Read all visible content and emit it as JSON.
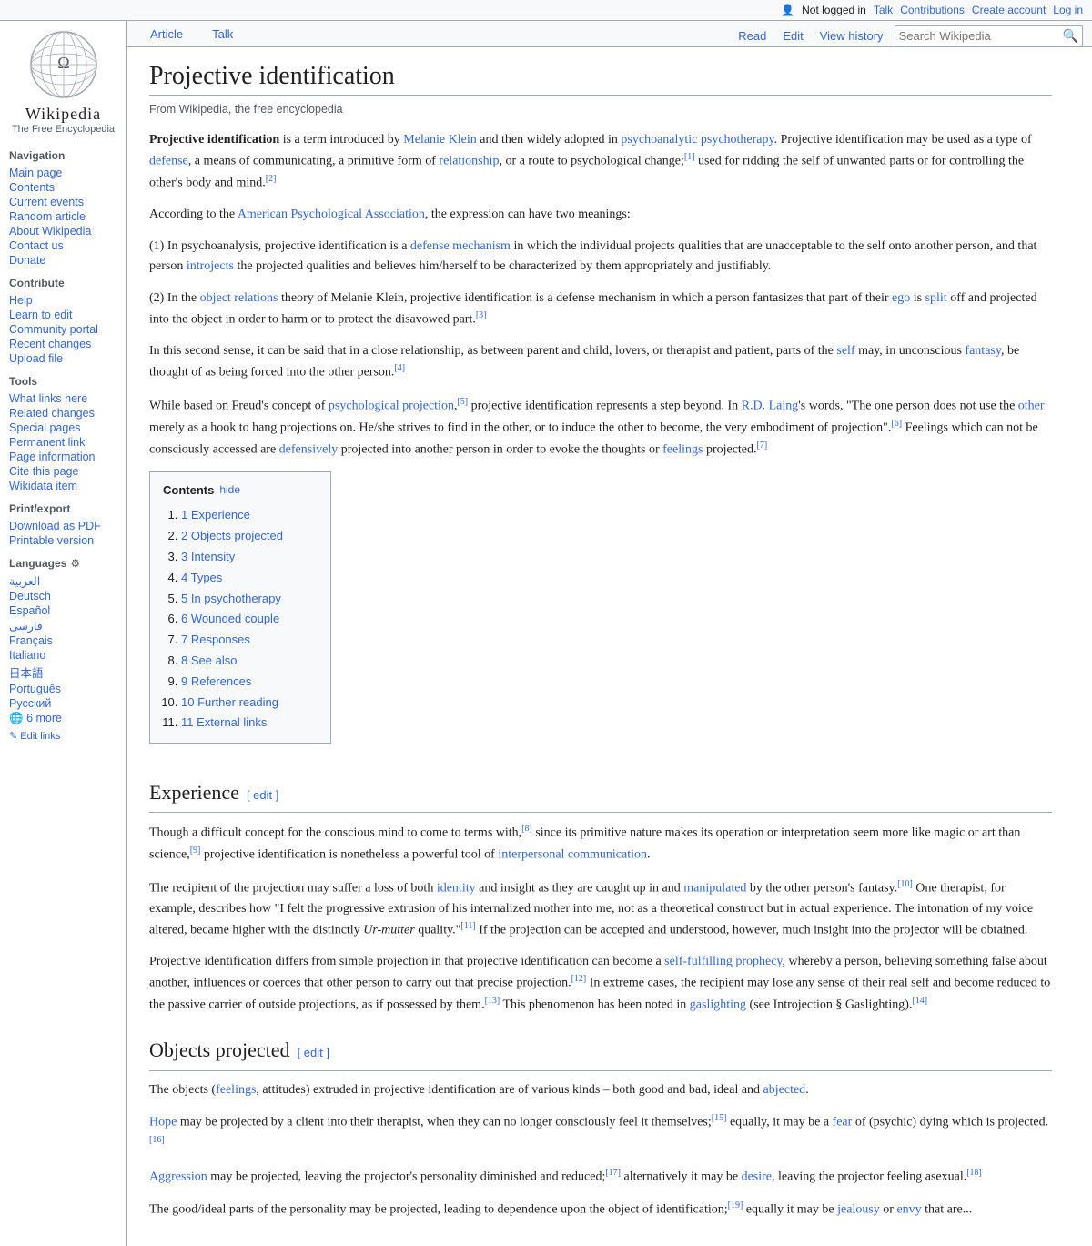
{
  "topbar": {
    "not_logged_in": "Not logged in",
    "talk": "Talk",
    "contributions": "Contributions",
    "create_account": "Create account",
    "log_in": "Log in"
  },
  "logo": {
    "title": "Wikipedia",
    "subtitle": "The Free Encyclopedia"
  },
  "sidebar": {
    "navigation_title": "Navigation",
    "items_nav": [
      {
        "label": "Main page",
        "id": "main-page"
      },
      {
        "label": "Contents",
        "id": "contents"
      },
      {
        "label": "Current events",
        "id": "current-events"
      },
      {
        "label": "Random article",
        "id": "random-article"
      },
      {
        "label": "About Wikipedia",
        "id": "about-wikipedia"
      },
      {
        "label": "Contact us",
        "id": "contact-us"
      },
      {
        "label": "Donate",
        "id": "donate"
      }
    ],
    "contribute_title": "Contribute",
    "items_contribute": [
      {
        "label": "Help",
        "id": "help"
      },
      {
        "label": "Learn to edit",
        "id": "learn-to-edit"
      },
      {
        "label": "Community portal",
        "id": "community-portal"
      },
      {
        "label": "Recent changes",
        "id": "recent-changes"
      },
      {
        "label": "Upload file",
        "id": "upload-file"
      }
    ],
    "tools_title": "Tools",
    "items_tools": [
      {
        "label": "What links here",
        "id": "what-links-here"
      },
      {
        "label": "Related changes",
        "id": "related-changes"
      },
      {
        "label": "Special pages",
        "id": "special-pages"
      },
      {
        "label": "Permanent link",
        "id": "permanent-link"
      },
      {
        "label": "Page information",
        "id": "page-information"
      },
      {
        "label": "Cite this page",
        "id": "cite-this-page"
      },
      {
        "label": "Wikidata item",
        "id": "wikidata-item"
      }
    ],
    "print_title": "Print/export",
    "items_print": [
      {
        "label": "Download as PDF",
        "id": "download-pdf"
      },
      {
        "label": "Printable version",
        "id": "printable-version"
      }
    ],
    "languages_title": "Languages",
    "languages": [
      {
        "label": "العربية",
        "id": "lang-ar"
      },
      {
        "label": "Deutsch",
        "id": "lang-de"
      },
      {
        "label": "Español",
        "id": "lang-es"
      },
      {
        "label": "فارسی",
        "id": "lang-fa"
      },
      {
        "label": "Français",
        "id": "lang-fr"
      },
      {
        "label": "Italiano",
        "id": "lang-it"
      },
      {
        "label": "日本語",
        "id": "lang-ja"
      },
      {
        "label": "Português",
        "id": "lang-pt"
      },
      {
        "label": "Русский",
        "id": "lang-ru"
      }
    ],
    "more_languages": "6 more",
    "edit_links": "✎ Edit links"
  },
  "tabs": {
    "article": "Article",
    "talk": "Talk",
    "read": "Read",
    "edit": "Edit",
    "view_history": "View history",
    "search_placeholder": "Search Wikipedia"
  },
  "page": {
    "title": "Projective identification",
    "from_wiki": "From Wikipedia, the free encyclopedia",
    "intro": [
      {
        "text": "Projective identification",
        "bold": true
      }
    ],
    "intro_rest": " is a term introduced by Melanie Klein and then widely adopted in psychoanalytic psychotherapy. Projective identification may be used as a type of defense, a means of communicating, a primitive form of relationship, or a route to psychological change;[1] used for ridding the self of unwanted parts or for controlling the other's body and mind.[2]",
    "para2": "According to the American Psychological Association, the expression can have two meanings:",
    "para3": "(1) In psychoanalysis, projective identification is a defense mechanism in which the individual projects qualities that are unacceptable to the self onto another person, and that person introjects the projected qualities and believes him/herself to be characterized by them appropriately and justifiably.",
    "para4": "(2) In the object relations theory of Melanie Klein, projective identification is a defense mechanism in which a person fantasizes that part of their ego is split off and projected into the object in order to harm or to protect the disavowed part.[3]",
    "para5": "In this second sense, it can be said that in a close relationship, as between parent and child, lovers, or therapist and patient, parts of the self may, in unconscious fantasy, be thought of as being forced into the other person.[4]",
    "para6": "While based on Freud's concept of psychological projection,[5] projective identification represents a step beyond. In R.D. Laing's words, \"The one person does not use the other merely as a hook to hang projections on. He/she strives to find in the other, or to induce the other to become, the very embodiment of projection\".[6] Feelings which can not be consciously accessed are defensively projected into another person in order to evoke the thoughts or feelings projected.[7]",
    "toc": {
      "title": "Contents",
      "hide": "hide",
      "items": [
        {
          "num": "1",
          "label": "Experience"
        },
        {
          "num": "2",
          "label": "Objects projected"
        },
        {
          "num": "3",
          "label": "Intensity"
        },
        {
          "num": "4",
          "label": "Types"
        },
        {
          "num": "5",
          "label": "In psychotherapy"
        },
        {
          "num": "6",
          "label": "Wounded couple"
        },
        {
          "num": "7",
          "label": "Responses"
        },
        {
          "num": "8",
          "label": "See also"
        },
        {
          "num": "9",
          "label": "References"
        },
        {
          "num": "10",
          "label": "Further reading"
        },
        {
          "num": "11",
          "label": "External links"
        }
      ]
    },
    "sections": [
      {
        "id": "experience",
        "title": "Experience",
        "edit_label": "edit",
        "paragraphs": [
          "Though a difficult concept for the conscious mind to come to terms with,[8] since its primitive nature makes its operation or interpretation seem more like magic or art than science,[9] projective identification is nonetheless a powerful tool of interpersonal communication.",
          "The recipient of the projection may suffer a loss of both identity and insight as they are caught up in and manipulated by the other person's fantasy.[10] One therapist, for example, describes how \"I felt the progressive extrusion of his internalized mother into me, not as a theoretical construct but in actual experience. The intonation of my voice altered, became higher with the distinctly Ur-mutter quality.\"[11] If the projection can be accepted and understood, however, much insight into the projector will be obtained.",
          "Projective identification differs from simple projection in that projective identification can become a self-fulfilling prophecy, whereby a person, believing something false about another, influences or coerces that other person to carry out that precise projection.[12] In extreme cases, the recipient may lose any sense of their real self and become reduced to the passive carrier of outside projections, as if possessed by them.[13] This phenomenon has been noted in gaslighting (see Introjection § Gaslighting).[14]"
        ]
      },
      {
        "id": "objects-projected",
        "title": "Objects projected",
        "edit_label": "edit",
        "paragraphs": [
          "The objects (feelings, attitudes) extruded in projective identification are of various kinds – both good and bad, ideal and abjected.",
          "Hope may be projected by a client into their therapist, when they can no longer consciously feel it themselves;[15] equally, it may be a fear of (psychic) dying which is projected.[16]",
          "Aggression may be projected, leaving the projector's personality diminished and reduced;[17] alternatively it may be desire, leaving the projector feeling asexual.[18]",
          "The good/ideal parts of the personality may be projected, leading to dependence upon the object of identification;[19] equally it may be jealousy or envy that are..."
        ]
      }
    ]
  }
}
